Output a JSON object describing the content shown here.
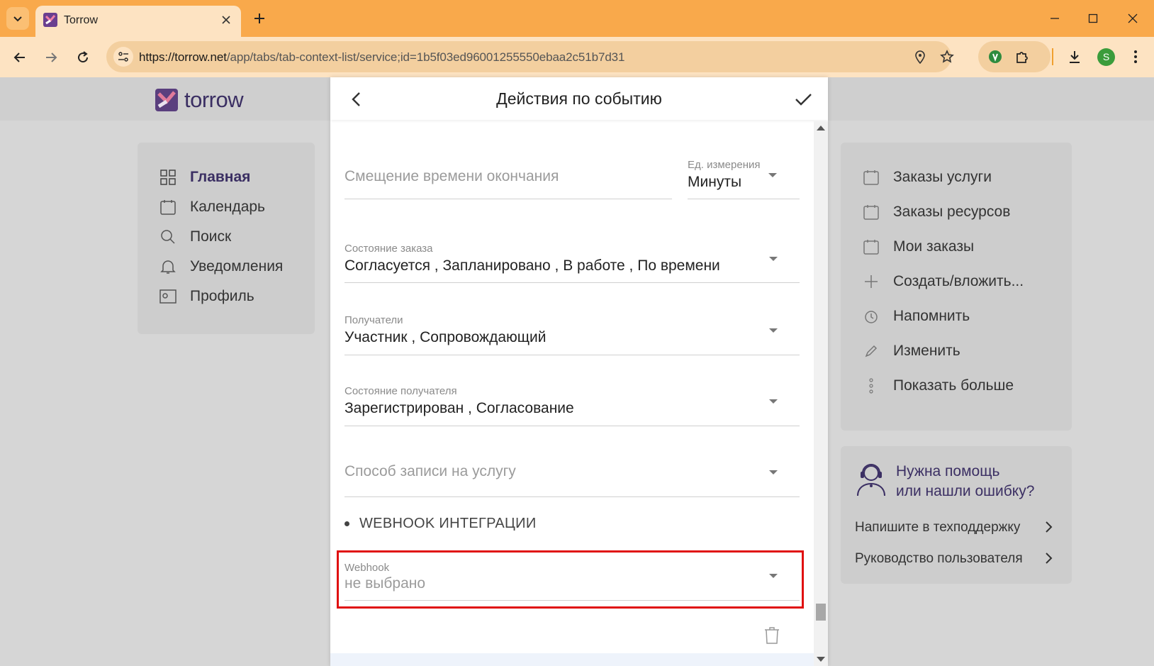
{
  "browser": {
    "tab_title": "Torrow",
    "url_host": "https://torrow.net",
    "url_path": "/app/tabs/tab-context-list/service;id=1b5f03ed96001255550ebaa2c51b7d31",
    "profile_initial": "S",
    "colors": {
      "titlebar": "#f9a94b",
      "toolbar": "#fde3c2"
    }
  },
  "app": {
    "logo_text": "torrow",
    "left_menu": [
      {
        "label": "Главная",
        "icon": "grid-icon",
        "active": true
      },
      {
        "label": "Календарь",
        "icon": "calendar-icon"
      },
      {
        "label": "Поиск",
        "icon": "search-icon"
      },
      {
        "label": "Уведомления",
        "icon": "bell-icon"
      },
      {
        "label": "Профиль",
        "icon": "profile-card-icon"
      }
    ],
    "right_menu": [
      {
        "label": "Заказы услуги",
        "icon": "calendar-icon"
      },
      {
        "label": "Заказы ресурсов",
        "icon": "calendar-icon"
      },
      {
        "label": "Мои заказы",
        "icon": "calendar-icon"
      },
      {
        "label": "Создать/вложить...",
        "icon": "plus-icon"
      },
      {
        "label": "Напомнить",
        "icon": "alarm-icon"
      },
      {
        "label": "Изменить",
        "icon": "pencil-icon"
      },
      {
        "label": "Показать больше",
        "icon": "more-vertical-icon"
      }
    ],
    "help": {
      "title_line1": "Нужна помощь",
      "title_line2": "или нашли ошибку?",
      "links": [
        "Напишите в техподдержку",
        "Руководство пользователя"
      ]
    }
  },
  "modal": {
    "title": "Действия по событию",
    "fields": {
      "end_offset": {
        "placeholder": "Смещение времени окончания"
      },
      "unit": {
        "label": "Ед. измерения",
        "value": "Минуты"
      },
      "order_state": {
        "label": "Состояние заказа",
        "value": "Согласуется , Запланировано , В работе , По времени"
      },
      "recipients": {
        "label": "Получатели",
        "value": "Участник , Сопровождающий"
      },
      "recipient_state": {
        "label": "Состояние получателя",
        "value": "Зарегистрирован , Согласование"
      },
      "booking_method": {
        "placeholder": "Способ записи на услугу"
      },
      "webhook": {
        "label": "Webhook",
        "placeholder": "не выбрано"
      }
    },
    "section_webhook": "WEBHOOK ИНТЕГРАЦИИ",
    "highlight_color": "#e01010"
  }
}
